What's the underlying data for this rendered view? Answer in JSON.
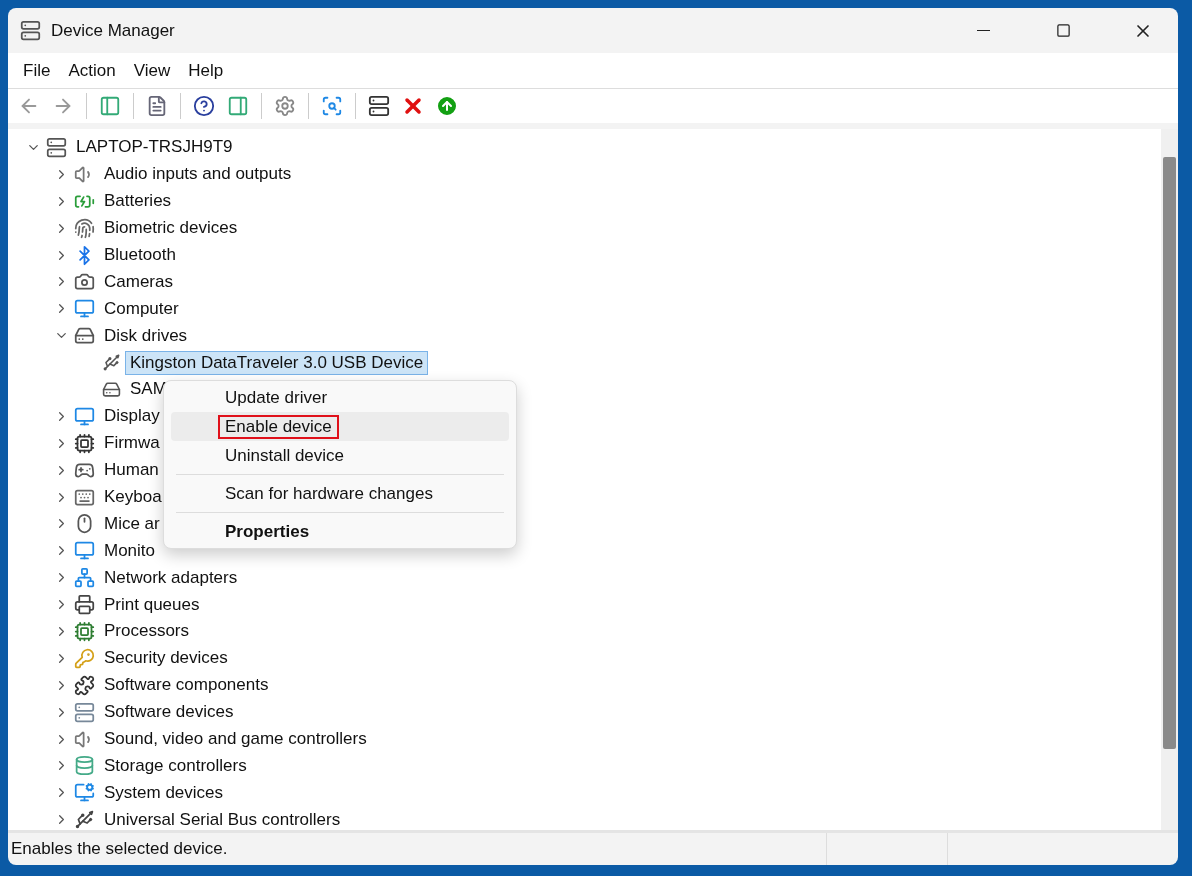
{
  "window": {
    "title": "Device Manager"
  },
  "menu_bar": [
    "File",
    "Action",
    "View",
    "Help"
  ],
  "tree": {
    "label": "LAPTOP-TRSJH9T9",
    "expanded": true,
    "selected": false,
    "children": [
      {
        "label": "Audio inputs and outputs",
        "expanded": false,
        "selected": false
      },
      {
        "label": "Batteries",
        "expanded": false,
        "selected": false
      },
      {
        "label": "Biometric devices",
        "expanded": false,
        "selected": false
      },
      {
        "label": "Bluetooth",
        "expanded": false,
        "selected": false
      },
      {
        "label": "Cameras",
        "expanded": false,
        "selected": false
      },
      {
        "label": "Computer",
        "expanded": false,
        "selected": false
      },
      {
        "label": "Disk drives",
        "expanded": true,
        "selected": false,
        "children": [
          {
            "label": "Kingston DataTraveler 3.0 USB Device",
            "selected": true
          },
          {
            "label": "SAM",
            "selected": false
          }
        ]
      },
      {
        "label": "Display",
        "expanded": false,
        "selected": false
      },
      {
        "label": "Firmwa",
        "expanded": false,
        "selected": false
      },
      {
        "label": "Human",
        "expanded": false,
        "selected": false
      },
      {
        "label": "Keyboa",
        "expanded": false,
        "selected": false
      },
      {
        "label": "Mice ar",
        "expanded": false,
        "selected": false
      },
      {
        "label": "Monito",
        "expanded": false,
        "selected": false
      },
      {
        "label": "Network adapters",
        "expanded": false,
        "selected": false
      },
      {
        "label": "Print queues",
        "expanded": false,
        "selected": false
      },
      {
        "label": "Processors",
        "expanded": false,
        "selected": false
      },
      {
        "label": "Security devices",
        "expanded": false,
        "selected": false
      },
      {
        "label": "Software components",
        "expanded": false,
        "selected": false
      },
      {
        "label": "Software devices",
        "expanded": false,
        "selected": false
      },
      {
        "label": "Sound, video and game controllers",
        "expanded": false,
        "selected": false
      },
      {
        "label": "Storage controllers",
        "expanded": false,
        "selected": false
      },
      {
        "label": "System devices",
        "expanded": false,
        "selected": false
      },
      {
        "label": "Universal Serial Bus controllers",
        "expanded": false,
        "selected": false
      }
    ]
  },
  "context_menu": [
    {
      "kind": "item",
      "label": "Update driver",
      "selected": false,
      "highlighted": false
    },
    {
      "kind": "item",
      "label": "Enable device",
      "selected": true,
      "highlighted": true
    },
    {
      "kind": "item",
      "label": "Uninstall device",
      "selected": false,
      "highlighted": false
    },
    {
      "kind": "separator"
    },
    {
      "kind": "item",
      "label": "Scan for hardware changes",
      "selected": false,
      "highlighted": false
    },
    {
      "kind": "separator"
    },
    {
      "kind": "default",
      "label": "Properties",
      "selected": false,
      "highlighted": false
    }
  ],
  "status_bar": {
    "text": "Enables the selected device."
  }
}
